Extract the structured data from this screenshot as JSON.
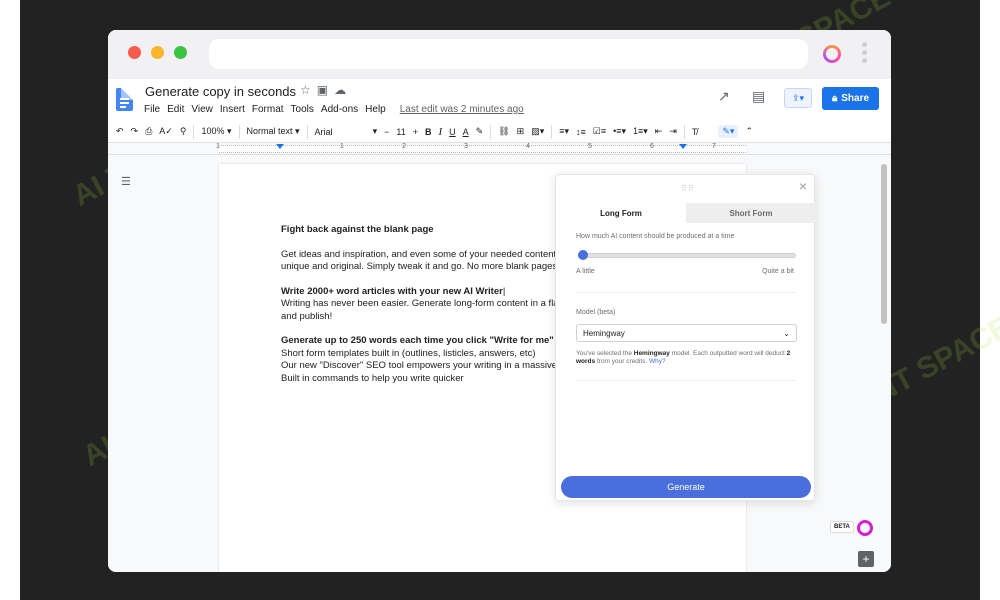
{
  "document": {
    "title": "Generate copy in seconds",
    "last_edit": "Last edit was 2 minutes ago",
    "menu": [
      "File",
      "Edit",
      "View",
      "Insert",
      "Format",
      "Tools",
      "Add-ons",
      "Help"
    ],
    "share_label": "Share",
    "content": {
      "h1": "Fight back against the blank page",
      "p1a": "Get ideas and inspiration, and even some of your needed content",
      "p1b": "unique and original. Simply tweak it and go. No more blank pages",
      "h2": "Write 2000+ word articles with your new AI Writer",
      "p2a": "Writing has never been easier. Generate long-form content in a fla",
      "p2b": "and publish!",
      "h3": "Generate up to 250 words each time you click \"Write for me\"",
      "l1": "Short form templates built in (outlines, listicles, answers, etc)",
      "l2": "Our new \"Discover\" SEO tool empowers your writing in a massive",
      "l3": "Built in commands to help you write quicker"
    }
  },
  "toolbar": {
    "zoom": "100%",
    "style": "Normal text",
    "font": "Arial",
    "font_size": "11",
    "minus": "−",
    "plus": "+",
    "bold": "B",
    "italic": "I",
    "underline": "U",
    "text_color": "A"
  },
  "ruler": {
    "numbers": [
      "1",
      "1",
      "2",
      "3",
      "4",
      "5",
      "6",
      "7"
    ]
  },
  "ai_panel": {
    "tabs": [
      {
        "label": "Long Form",
        "active": true
      },
      {
        "label": "Short Form",
        "active": false
      }
    ],
    "question": "How much AI content should be produced at a time",
    "slider_min_label": "A little",
    "slider_max_label": "Quite a bit",
    "slider_value": 0,
    "model_label": "Model (beta)",
    "model_selected": "Hemingway",
    "note_prefix": "You've selected the",
    "note_model": "Hemingway",
    "note_mid": "model. Each outputted word will deduct",
    "note_words": "2 words",
    "note_suffix": "from your credits.",
    "note_why": "Why?",
    "generate_label": "Generate"
  },
  "beta_label": "BETA",
  "colors": {
    "accent": "#4a6fdc",
    "share_button": "#1a73e8",
    "docs_blue": "#4285f4",
    "background": "#222222"
  },
  "watermark": "AI TALENT SPACE"
}
